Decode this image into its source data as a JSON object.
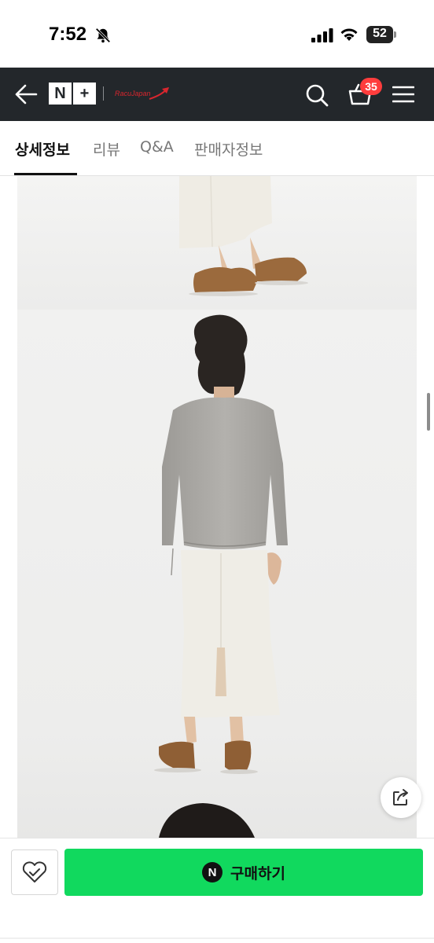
{
  "status_bar": {
    "time": "7:52",
    "battery": "52",
    "icons": [
      "bell-slash-icon",
      "signal-icon",
      "wifi-icon",
      "battery-icon"
    ]
  },
  "header": {
    "logo_text_1": "N",
    "logo_text_2": "+",
    "brand_text": "RacuJapan",
    "cart_count": "35",
    "icons": [
      "back-arrow-icon",
      "search-icon",
      "cart-icon",
      "hamburger-menu-icon"
    ],
    "background": "#23272b"
  },
  "tabs": [
    {
      "label": "상세정보",
      "active": true
    },
    {
      "label": "리뷰",
      "active": false
    },
    {
      "label": "Q&A",
      "active": false
    },
    {
      "label": "판매자정보",
      "active": false
    }
  ],
  "bottom_bar": {
    "wish_icon": "heart-check-icon",
    "npay_letter": "N",
    "buy_label": "구매하기",
    "buy_color": "#11d95e"
  },
  "content": {
    "share_icon": "share-icon"
  }
}
